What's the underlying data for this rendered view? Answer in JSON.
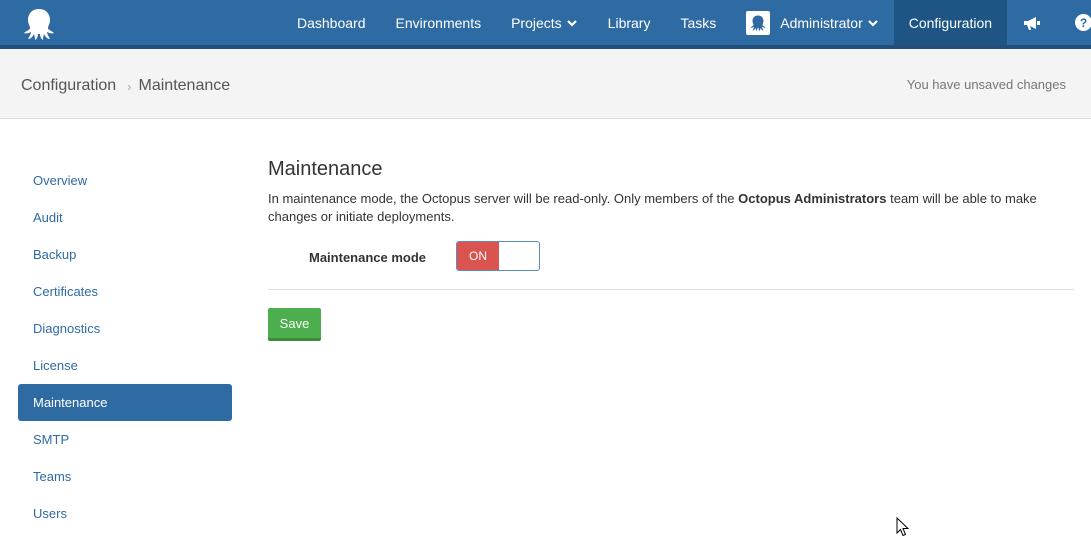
{
  "nav": {
    "items": [
      {
        "label": "Dashboard"
      },
      {
        "label": "Environments"
      },
      {
        "label": "Projects"
      },
      {
        "label": "Library"
      },
      {
        "label": "Tasks"
      }
    ],
    "user": "Administrator",
    "configuration": "Configuration"
  },
  "header": {
    "breadcrumb_root": "Configuration",
    "breadcrumb_current": "Maintenance",
    "status": "You have unsaved changes"
  },
  "sidebar": {
    "items": [
      {
        "label": "Overview"
      },
      {
        "label": "Audit"
      },
      {
        "label": "Backup"
      },
      {
        "label": "Certificates"
      },
      {
        "label": "Diagnostics"
      },
      {
        "label": "License"
      },
      {
        "label": "Maintenance"
      },
      {
        "label": "SMTP"
      },
      {
        "label": "Teams"
      },
      {
        "label": "Users"
      }
    ]
  },
  "main": {
    "title": "Maintenance",
    "desc_prefix": "In maintenance mode, the Octopus server will be read-only. Only members of the ",
    "desc_bold": "Octopus Administrators",
    "desc_suffix": " team will be able to make changes or initiate deployments.",
    "field_label": "Maintenance mode",
    "toggle_state": "ON",
    "save_label": "Save"
  },
  "colors": {
    "nav_bg": "#2f6ba3",
    "toggle_on": "#d9534f",
    "save_button": "#4cae4c"
  }
}
